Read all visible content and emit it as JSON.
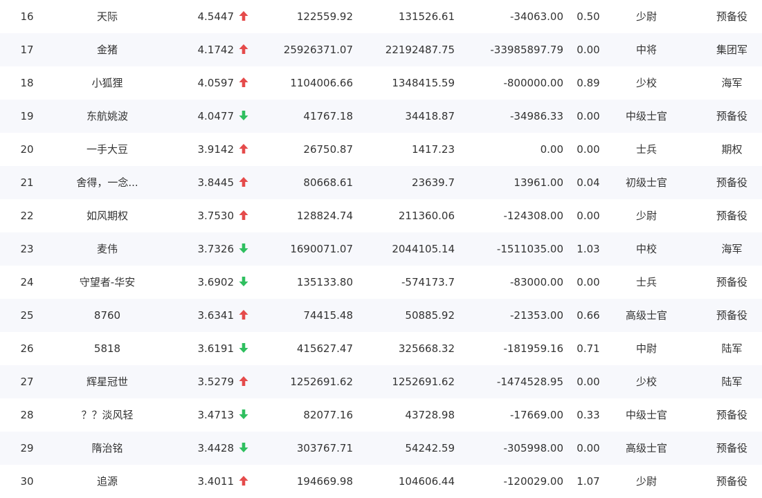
{
  "colors": {
    "up_arrow": "#e54b4b",
    "down_arrow": "#2fbf5f",
    "alt_row": "#f7f8fc",
    "text": "#333333"
  },
  "rows": [
    {
      "rank": "16",
      "name": "天际",
      "score": "4.5447",
      "trend": "up",
      "trend_icon": "arrow-up-icon",
      "value1": "122559.92",
      "value2": "131526.61",
      "value3": "-34063.00",
      "ratio": "0.50",
      "military_rank": "少尉",
      "branch": "预备役"
    },
    {
      "rank": "17",
      "name": "金猪",
      "score": "4.1742",
      "trend": "up",
      "trend_icon": "arrow-up-icon",
      "value1": "25926371.07",
      "value2": "22192487.75",
      "value3": "-33985897.79",
      "ratio": "0.00",
      "military_rank": "中将",
      "branch": "集团军"
    },
    {
      "rank": "18",
      "name": "小狐狸",
      "score": "4.0597",
      "trend": "up",
      "trend_icon": "arrow-up-icon",
      "value1": "1104006.66",
      "value2": "1348415.59",
      "value3": "-800000.00",
      "ratio": "0.89",
      "military_rank": "少校",
      "branch": "海军"
    },
    {
      "rank": "19",
      "name": "东航姚波",
      "score": "4.0477",
      "trend": "down",
      "trend_icon": "arrow-down-icon",
      "value1": "41767.18",
      "value2": "34418.87",
      "value3": "-34986.33",
      "ratio": "0.00",
      "military_rank": "中级士官",
      "branch": "预备役"
    },
    {
      "rank": "20",
      "name": "一手大豆",
      "score": "3.9142",
      "trend": "up",
      "trend_icon": "arrow-up-icon",
      "value1": "26750.87",
      "value2": "1417.23",
      "value3": "0.00",
      "ratio": "0.00",
      "military_rank": "士兵",
      "branch": "期权"
    },
    {
      "rank": "21",
      "name": "舍得，一念...",
      "score": "3.8445",
      "trend": "up",
      "trend_icon": "arrow-up-icon",
      "value1": "80668.61",
      "value2": "23639.7",
      "value3": "13961.00",
      "ratio": "0.04",
      "military_rank": "初级士官",
      "branch": "预备役"
    },
    {
      "rank": "22",
      "name": "如风期权",
      "score": "3.7530",
      "trend": "up",
      "trend_icon": "arrow-up-icon",
      "value1": "128824.74",
      "value2": "211360.06",
      "value3": "-124308.00",
      "ratio": "0.00",
      "military_rank": "少尉",
      "branch": "预备役"
    },
    {
      "rank": "23",
      "name": "麦伟",
      "score": "3.7326",
      "trend": "down",
      "trend_icon": "arrow-down-icon",
      "value1": "1690071.07",
      "value2": "2044105.14",
      "value3": "-1511035.00",
      "ratio": "1.03",
      "military_rank": "中校",
      "branch": "海军"
    },
    {
      "rank": "24",
      "name": "守望者-华安",
      "score": "3.6902",
      "trend": "down",
      "trend_icon": "arrow-down-icon",
      "value1": "135133.80",
      "value2": "-574173.7",
      "value3": "-83000.00",
      "ratio": "0.00",
      "military_rank": "士兵",
      "branch": "预备役"
    },
    {
      "rank": "25",
      "name": "8760",
      "score": "3.6341",
      "trend": "up",
      "trend_icon": "arrow-up-icon",
      "value1": "74415.48",
      "value2": "50885.92",
      "value3": "-21353.00",
      "ratio": "0.66",
      "military_rank": "高级士官",
      "branch": "预备役"
    },
    {
      "rank": "26",
      "name": "5818",
      "score": "3.6191",
      "trend": "down",
      "trend_icon": "arrow-down-icon",
      "value1": "415627.47",
      "value2": "325668.32",
      "value3": "-181959.16",
      "ratio": "0.71",
      "military_rank": "中尉",
      "branch": "陆军"
    },
    {
      "rank": "27",
      "name": "辉星冠世",
      "score": "3.5279",
      "trend": "up",
      "trend_icon": "arrow-up-icon",
      "value1": "1252691.62",
      "value2": "1252691.62",
      "value3": "-1474528.95",
      "ratio": "0.00",
      "military_rank": "少校",
      "branch": "陆军"
    },
    {
      "rank": "28",
      "name": "？？淡风轻",
      "score": "3.4713",
      "trend": "down",
      "trend_icon": "arrow-down-icon",
      "value1": "82077.16",
      "value2": "43728.98",
      "value3": "-17669.00",
      "ratio": "0.33",
      "military_rank": "中级士官",
      "branch": "预备役"
    },
    {
      "rank": "29",
      "name": "隋治铭",
      "score": "3.4428",
      "trend": "down",
      "trend_icon": "arrow-down-icon",
      "value1": "303767.71",
      "value2": "54242.59",
      "value3": "-305998.00",
      "ratio": "0.00",
      "military_rank": "高级士官",
      "branch": "预备役"
    },
    {
      "rank": "30",
      "name": "追源",
      "score": "3.4011",
      "trend": "up",
      "trend_icon": "arrow-up-icon",
      "value1": "194669.98",
      "value2": "104606.44",
      "value3": "-120029.00",
      "ratio": "1.07",
      "military_rank": "少尉",
      "branch": "预备役"
    }
  ]
}
